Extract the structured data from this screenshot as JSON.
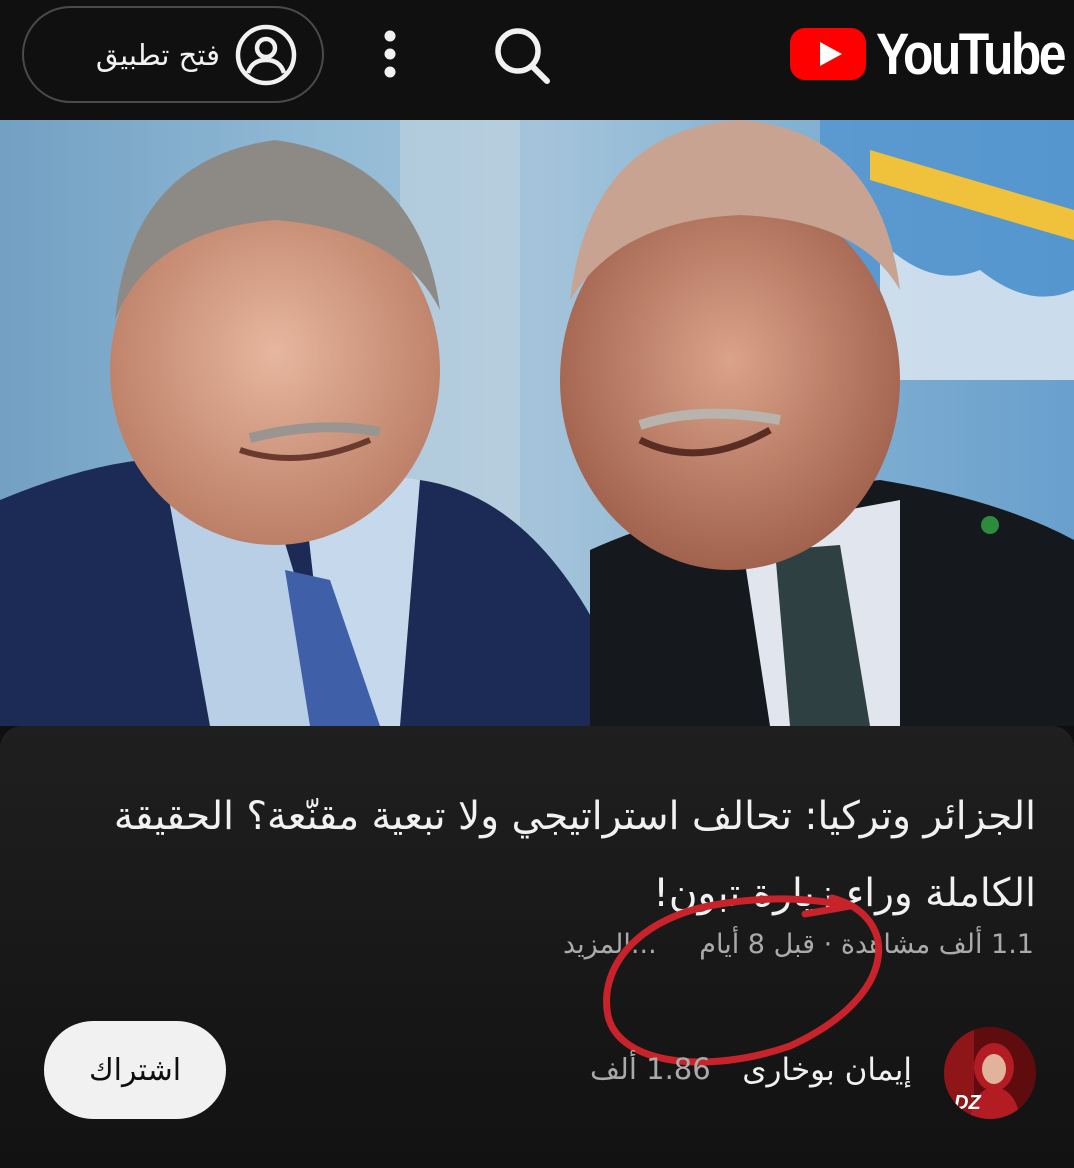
{
  "header": {
    "logo_text": "YouTube",
    "open_app_label": "فتح تطبيق",
    "icons": {
      "account": "account-circle-icon",
      "more": "more-vert-icon",
      "search": "search-icon",
      "logo": "youtube-play-icon"
    },
    "brand_color": "#FF0000"
  },
  "video": {
    "title": "الجزائر وتركيا: تحالف استراتيجي ولا تبعية مقنّعة؟ الحقيقة الكاملة وراء زيارة تبون!",
    "views": "1.1 ألف مشاهدة",
    "separator": "·",
    "age": "قبل 8 أيام",
    "more_label": "...المزيد"
  },
  "channel": {
    "name": "إيمان بوخارى",
    "subscribers": "1.86 ألف",
    "avatar_text": "DZ",
    "subscribe_label": "اشتراك"
  },
  "annotation_color": "#c8232b"
}
